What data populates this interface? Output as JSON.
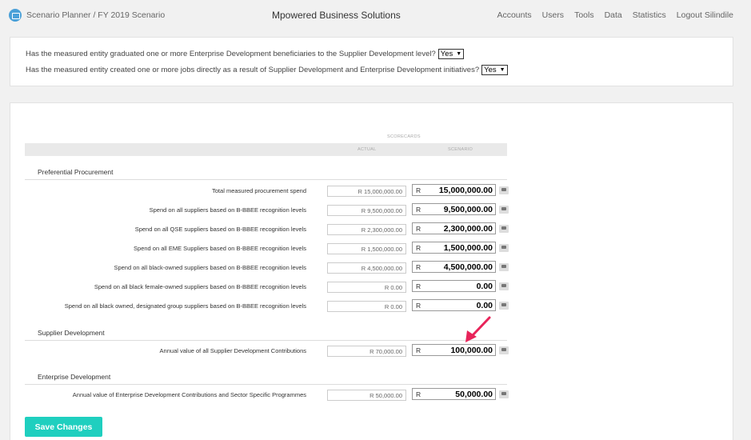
{
  "header": {
    "breadcrumb": "Scenario Planner / FY 2019 Scenario",
    "brand": "Mpowered Business Solutions",
    "nav": [
      "Accounts",
      "Users",
      "Tools",
      "Data",
      "Statistics",
      "Logout Silindile"
    ]
  },
  "questions": [
    {
      "text": "Has the measured entity graduated one or more Enterprise Development beneficiaries to the Supplier Development level?",
      "answer": "Yes"
    },
    {
      "text": "Has the measured entity created one or more jobs directly as a result of Supplier Development and Enterprise Development initiatives?",
      "answer": "Yes"
    }
  ],
  "table": {
    "scorecards_label": "SCORECARDS",
    "actual_label": "ACTUAL",
    "scenario_label": "SCENARIO",
    "currency": "R",
    "sections": {
      "pp": "Preferential Procurement",
      "sd": "Supplier Development",
      "ed": "Enterprise Development"
    },
    "rows": [
      {
        "label": "Total measured procurement spend",
        "actual": "R 15,000,000.00",
        "scenario": "15,000,000.00"
      },
      {
        "label": "Spend on all suppliers based on B-BBEE recognition levels",
        "actual": "R 9,500,000.00",
        "scenario": "9,500,000.00"
      },
      {
        "label": "Spend on all QSE suppliers based on B-BBEE recognition levels",
        "actual": "R 2,300,000.00",
        "scenario": "2,300,000.00"
      },
      {
        "label": "Spend on all EME Suppliers based on B-BBEE recognition levels",
        "actual": "R 1,500,000.00",
        "scenario": "1,500,000.00"
      },
      {
        "label": "Spend on all black-owned suppliers based on B-BBEE recognition levels",
        "actual": "R 4,500,000.00",
        "scenario": "4,500,000.00"
      },
      {
        "label": "Spend on all black female-owned suppliers based on B-BBEE recognition levels",
        "actual": "R 0.00",
        "scenario": "0.00"
      },
      {
        "label": "Spend on all black owned, designated group suppliers based on B-BBEE recognition levels",
        "actual": "R 0.00",
        "scenario": "0.00"
      },
      {
        "label": "Annual value of all Supplier Development Contributions",
        "actual": "R 70,000.00",
        "scenario": "100,000.00"
      },
      {
        "label": "Annual value of Enterprise Development Contributions and Sector Specific Programmes",
        "actual": "R 50,000.00",
        "scenario": "50,000.00"
      }
    ]
  },
  "save_label": "Save Changes",
  "colors": {
    "accent": "#1fcfbf",
    "annotation_arrow": "#e8245a"
  }
}
